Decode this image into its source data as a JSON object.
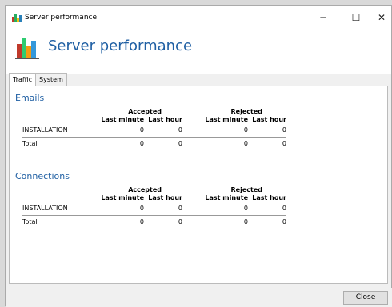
{
  "window": {
    "title": "Server performance"
  },
  "header": {
    "heading": "Server performance"
  },
  "controls": {
    "minimize": "─",
    "maximize": "☐",
    "close": "✕"
  },
  "tabs": [
    {
      "label": "Traffic",
      "active": true
    },
    {
      "label": "System",
      "active": false
    }
  ],
  "sections": [
    {
      "title": "Emails",
      "groups": [
        "Accepted",
        "Rejected"
      ],
      "columns": [
        "Last minute",
        "Last hour",
        "Last minute",
        "Last hour"
      ],
      "rows": [
        {
          "label": "INSTALLATION",
          "values": [
            "0",
            "0",
            "0",
            "0"
          ]
        }
      ],
      "total": {
        "label": "Total",
        "values": [
          "0",
          "0",
          "0",
          "0"
        ]
      }
    },
    {
      "title": "Connections",
      "groups": [
        "Accepted",
        "Rejected"
      ],
      "columns": [
        "Last minute",
        "Last hour",
        "Last minute",
        "Last hour"
      ],
      "rows": [
        {
          "label": "INSTALLATION",
          "values": [
            "0",
            "0",
            "0",
            "0"
          ]
        }
      ],
      "total": {
        "label": "Total",
        "values": [
          "0",
          "0",
          "0",
          "0"
        ]
      }
    }
  ],
  "footer": {
    "close_label": "Close"
  }
}
